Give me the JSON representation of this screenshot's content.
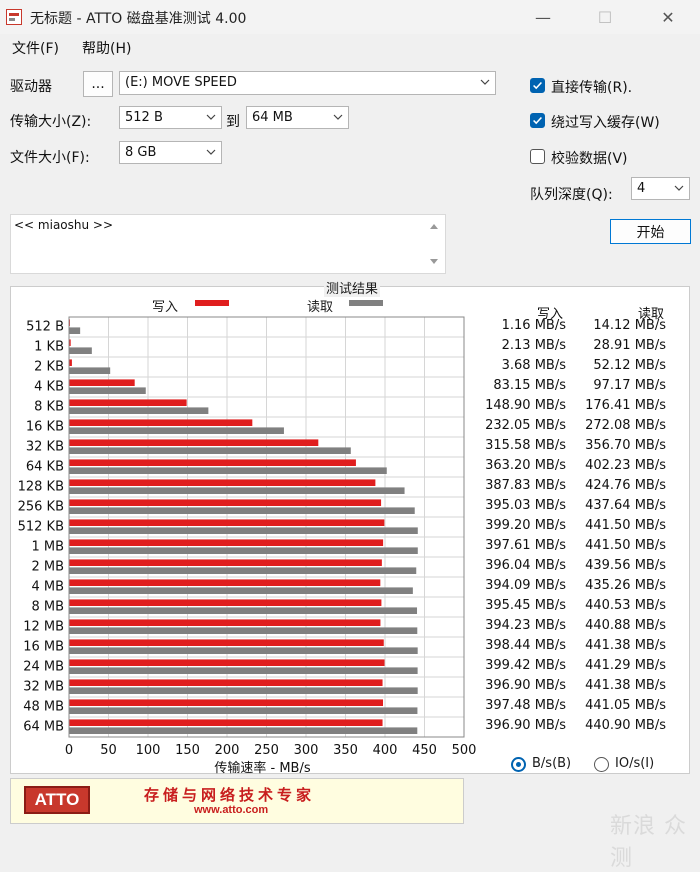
{
  "window": {
    "title": "无标题 - ATTO 磁盘基准测试 4.00",
    "minimize_glyph": "—",
    "maximize_glyph": "☐",
    "close_glyph": "✕"
  },
  "menu": {
    "file": "文件(F)",
    "help": "帮助(H)"
  },
  "settings": {
    "drive_label": "驱动器",
    "browse_label": "...",
    "drive_value": "(E:) MOVE SPEED",
    "transfer_label": "传输大小(Z):",
    "transfer_from": "512 B",
    "to_label": "到",
    "transfer_to": "64 MB",
    "filesize_label": "文件大小(F):",
    "filesize_value": "8 GB",
    "direct_io_label": "直接传输(R).",
    "direct_io_checked": true,
    "bypass_cache_label": "绕过写入缓存(W)",
    "bypass_cache_checked": true,
    "verify_label": "校验数据(V)",
    "verify_checked": false,
    "queue_label": "队列深度(Q):",
    "queue_value": "4",
    "start_label": "开始",
    "description": "<< miaoshu >>"
  },
  "results": {
    "title": "测试结果",
    "write_col": "写入",
    "read_col": "读取",
    "legend_write": "写入",
    "legend_read": "读取",
    "unit_bytes": "B/s(B)",
    "unit_io": "IO/s(I)",
    "unit_bytes_selected": true
  },
  "chart_data": {
    "type": "bar",
    "orientation": "horizontal",
    "xlabel": "传输速率 - MB/s",
    "xlim": [
      0,
      500
    ],
    "xticks": [
      0,
      50,
      100,
      150,
      200,
      250,
      300,
      350,
      400,
      450,
      500
    ],
    "grid": true,
    "legend_position": "top",
    "colors": {
      "write": "#e01e1e",
      "read": "#808080"
    },
    "categories": [
      "512 B",
      "1 KB",
      "2 KB",
      "4 KB",
      "8 KB",
      "16 KB",
      "32 KB",
      "64 KB",
      "128 KB",
      "256 KB",
      "512 KB",
      "1 MB",
      "2 MB",
      "4 MB",
      "8 MB",
      "12 MB",
      "16 MB",
      "24 MB",
      "32 MB",
      "48 MB",
      "64 MB"
    ],
    "series": [
      {
        "name": "写入",
        "values": [
          1.16,
          2.13,
          3.68,
          83.15,
          148.9,
          232.05,
          315.58,
          363.2,
          387.83,
          395.03,
          399.2,
          397.61,
          396.04,
          394.09,
          395.45,
          394.23,
          398.44,
          399.42,
          396.9,
          397.48,
          396.9
        ]
      },
      {
        "name": "读取",
        "values": [
          14.12,
          28.91,
          52.12,
          97.17,
          176.41,
          272.08,
          356.7,
          402.23,
          424.76,
          437.64,
          441.5,
          441.5,
          439.56,
          435.26,
          440.53,
          440.88,
          441.38,
          441.29,
          441.38,
          441.05,
          440.9
        ]
      }
    ],
    "write_text": [
      "1.16 MB/s",
      "2.13 MB/s",
      "3.68 MB/s",
      "83.15 MB/s",
      "148.90 MB/s",
      "232.05 MB/s",
      "315.58 MB/s",
      "363.20 MB/s",
      "387.83 MB/s",
      "395.03 MB/s",
      "399.20 MB/s",
      "397.61 MB/s",
      "396.04 MB/s",
      "394.09 MB/s",
      "395.45 MB/s",
      "394.23 MB/s",
      "398.44 MB/s",
      "399.42 MB/s",
      "396.90 MB/s",
      "397.48 MB/s",
      "396.90 MB/s"
    ],
    "read_text": [
      "14.12 MB/s",
      "28.91 MB/s",
      "52.12 MB/s",
      "97.17 MB/s",
      "176.41 MB/s",
      "272.08 MB/s",
      "356.70 MB/s",
      "402.23 MB/s",
      "424.76 MB/s",
      "437.64 MB/s",
      "441.50 MB/s",
      "441.50 MB/s",
      "439.56 MB/s",
      "435.26 MB/s",
      "440.53 MB/s",
      "440.88 MB/s",
      "441.38 MB/s",
      "441.29 MB/s",
      "441.38 MB/s",
      "441.05 MB/s",
      "440.90 MB/s"
    ]
  },
  "banner": {
    "logo_text": "ATTO",
    "slogan": "存储与网络技术专家",
    "url": "www.atto.com"
  },
  "watermark": "新浪 众测"
}
